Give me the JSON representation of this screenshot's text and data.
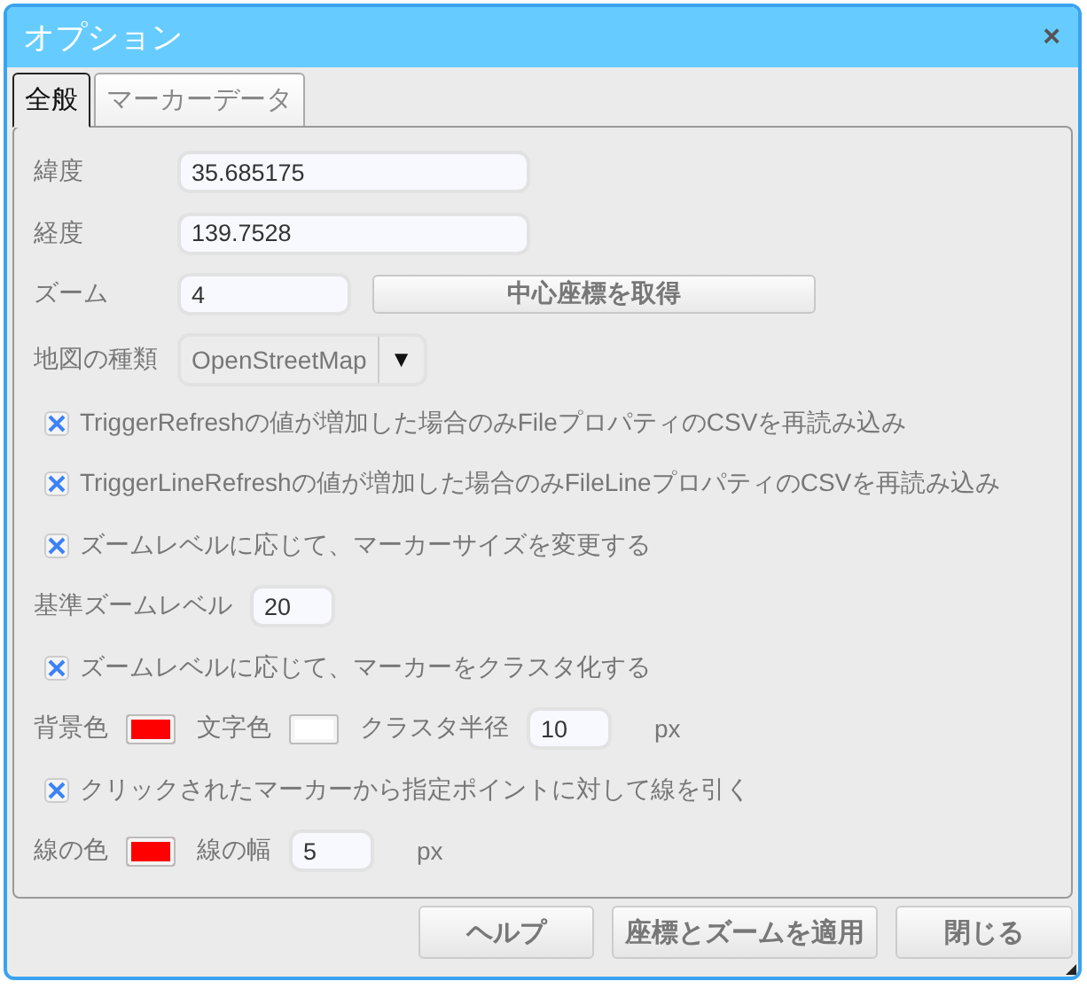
{
  "window": {
    "title": "オプション",
    "close": "×"
  },
  "tabs": [
    {
      "label": "全般",
      "selected": true
    },
    {
      "label": "マーカーデータ",
      "selected": false
    }
  ],
  "rows": [
    {
      "kind": "text",
      "label": "緯度",
      "value": "35.685175"
    },
    {
      "kind": "text",
      "label": "経度",
      "value": "139.7528"
    },
    {
      "kind": "zoom",
      "label": "ズーム",
      "value": "4",
      "button": "中心座標を取得"
    },
    {
      "kind": "select",
      "label": "地図の種類",
      "value": "OpenStreetMap",
      "arrow": "▼"
    },
    {
      "kind": "checkbox",
      "label": "TriggerRefreshの値が増加した場合のみFileプロパティのCSVを再読み込み",
      "checked": true
    },
    {
      "kind": "checkbox",
      "label": "TriggerLineRefreshの値が増加した場合のみFileLineプロパティのCSVを再読み込み",
      "checked": true
    },
    {
      "kind": "checkbox",
      "label": "ズームレベルに応じて、マーカーサイズを変更する",
      "checked": true
    },
    {
      "kind": "inline",
      "items": [
        {
          "kind": "label",
          "text": "基準ズームレベル"
        },
        {
          "kind": "input",
          "value": "20"
        }
      ]
    },
    {
      "kind": "checkbox",
      "label": "ズームレベルに応じて、マーカーをクラスタ化する",
      "checked": true
    },
    {
      "kind": "inline",
      "items": [
        {
          "kind": "label",
          "text": "背景色"
        },
        {
          "kind": "color",
          "color": "#ff0000"
        },
        {
          "kind": "label",
          "text": "文字色"
        },
        {
          "kind": "color",
          "color": "#ffffff"
        },
        {
          "kind": "label",
          "text": "クラスタ半径"
        },
        {
          "kind": "input",
          "value": "10"
        },
        {
          "kind": "unit",
          "text": "px"
        }
      ]
    },
    {
      "kind": "checkbox",
      "label": "クリックされたマーカーから指定ポイントに対して線を引く",
      "checked": true
    },
    {
      "kind": "inline",
      "items": [
        {
          "kind": "label",
          "text": "線の色"
        },
        {
          "kind": "color",
          "color": "#ff0000"
        },
        {
          "kind": "label",
          "text": "線の幅"
        },
        {
          "kind": "input",
          "value": "5"
        },
        {
          "kind": "unit",
          "text": "px"
        }
      ]
    }
  ],
  "buttons": [
    "ヘルプ",
    "座標とズームを適用",
    "閉じる"
  ]
}
